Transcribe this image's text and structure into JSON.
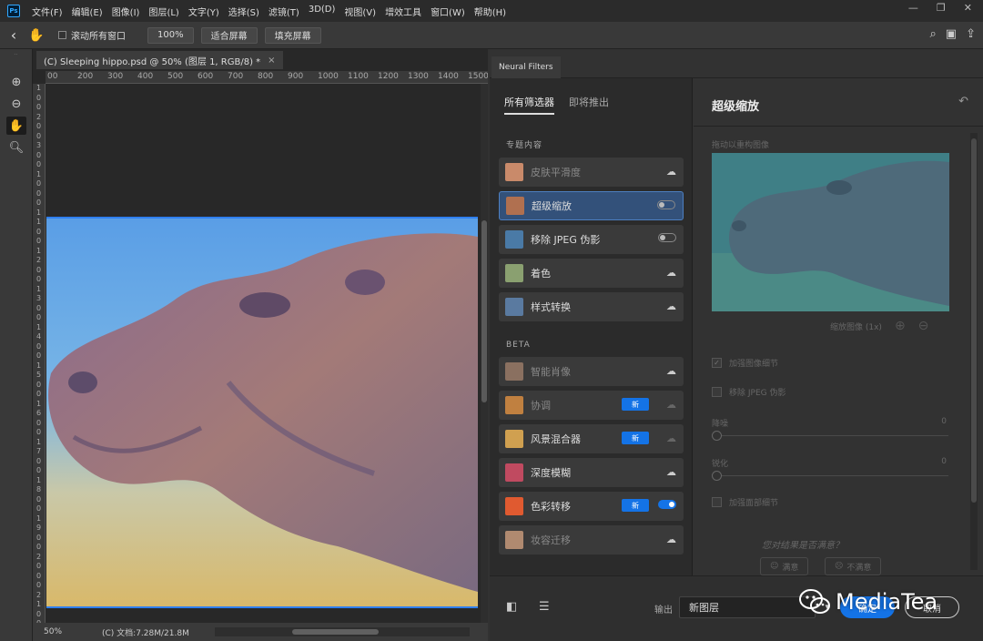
{
  "app": {
    "logo": "Ps"
  },
  "menu": [
    "文件(F)",
    "编辑(E)",
    "图像(I)",
    "图层(L)",
    "文字(Y)",
    "选择(S)",
    "滤镜(T)",
    "3D(D)",
    "视图(V)",
    "增效工具",
    "窗口(W)",
    "帮助(H)"
  ],
  "window_controls": {
    "minimize": "—",
    "restore": "❐",
    "close": "✕"
  },
  "options": {
    "scroll_all_label": "滚动所有窗口",
    "zoom_value": "100%",
    "fit_screen_label": "适合屏幕",
    "fill_screen_label": "填充屏幕"
  },
  "document": {
    "tab_title": "(C) Sleeping hippo.psd @ 50% (图层 1, RGB/8) *",
    "tab_close": "×",
    "zoom": "50%",
    "doc_info": "(C) 文档:7.28M/21.8M",
    "ruler_h": [
      "00",
      "200",
      "300",
      "400",
      "500",
      "600",
      "700",
      "800",
      "900",
      "1000",
      "1100",
      "1200",
      "1300",
      "1400",
      "1500"
    ],
    "ruler_v": [
      "1",
      "0",
      "0",
      "2",
      "0",
      "0",
      "3",
      "0",
      "0",
      "1",
      "0",
      "0",
      "0",
      "1",
      "1",
      "0",
      "0",
      "1",
      "2",
      "0",
      "0",
      "1",
      "3",
      "0",
      "0",
      "1",
      "4",
      "0",
      "0",
      "1",
      "5",
      "0",
      "0",
      "1",
      "6",
      "0",
      "0",
      "1",
      "7",
      "0",
      "0",
      "1",
      "8",
      "0",
      "0",
      "1",
      "9",
      "0",
      "0",
      "2",
      "0",
      "0",
      "0",
      "2",
      "1",
      "0",
      "0"
    ]
  },
  "neural_filters": {
    "panel_tab": "Neural Filters",
    "tab_all": "所有筛选器",
    "tab_coming": "即将推出",
    "section_featured": "专题内容",
    "section_beta": "BETA",
    "new_badge": "新",
    "featured": [
      {
        "label": "皮肤平滑度",
        "state": "cloud",
        "dim": true
      },
      {
        "label": "超级缩放",
        "state": "toggle-off",
        "selected": true
      },
      {
        "label": "移除 JPEG 伪影",
        "state": "toggle-off"
      },
      {
        "label": "着色",
        "state": "cloud"
      },
      {
        "label": "样式转换",
        "state": "cloud"
      }
    ],
    "beta": [
      {
        "label": "智能肖像",
        "state": "cloud",
        "dim": true
      },
      {
        "label": "协调",
        "state": "cloud-dim",
        "dim": true,
        "is_new": true
      },
      {
        "label": "风景混合器",
        "state": "cloud-dim",
        "is_new": true
      },
      {
        "label": "深度模糊",
        "state": "cloud"
      },
      {
        "label": "色彩转移",
        "state": "toggle-on",
        "is_new": true
      },
      {
        "label": "妆容迁移",
        "state": "cloud",
        "dim": true
      }
    ]
  },
  "settings": {
    "title": "超级缩放",
    "preview_label": "拖动以重构图像",
    "zoom_label": "缩放图像 (1x)",
    "enhance_detail": "加强图像细节",
    "enhance_detail_checked": true,
    "remove_jpeg": "移除 JPEG 伪影",
    "remove_jpeg_checked": false,
    "denoise_label": "降噪",
    "denoise_value": "0",
    "sharpen_label": "锐化",
    "sharpen_value": "0",
    "face_detail": "加强面部细节",
    "face_detail_checked": false,
    "feedback_question": "您对结果是否满意？",
    "satisfied": "满意",
    "unsatisfied": "不满意"
  },
  "output": {
    "label": "输出",
    "value": "新图层",
    "ok": "确定",
    "cancel": "取消"
  },
  "watermark": {
    "text": "MediaTea"
  },
  "colors": {
    "accent": "#1473e6",
    "selection": "#33517a",
    "panel": "#2b2b2b"
  }
}
